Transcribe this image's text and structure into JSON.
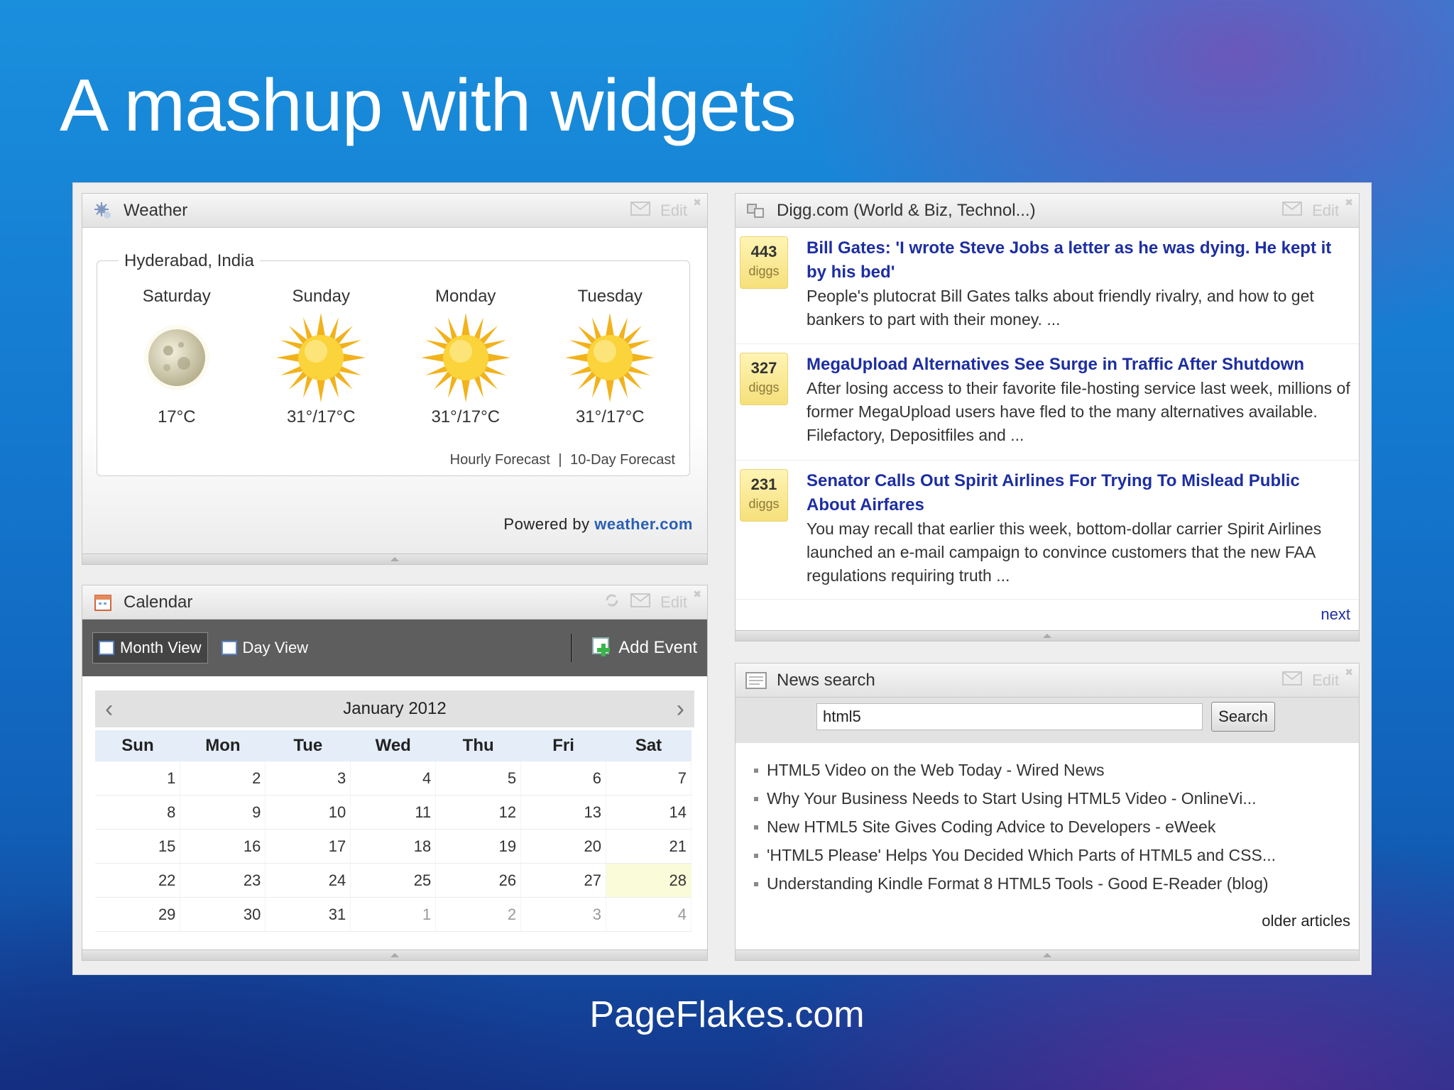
{
  "slide": {
    "title": "A mashup with widgets",
    "footer": "PageFlakes.com"
  },
  "widget_tools": {
    "edit_label": "Edit"
  },
  "weather": {
    "title": "Weather",
    "location": "Hyderabad, India",
    "days": [
      {
        "name": "Saturday",
        "icon": "moon-icon",
        "temp": "17°C"
      },
      {
        "name": "Sunday",
        "icon": "sun-icon",
        "temp": "31°/17°C"
      },
      {
        "name": "Monday",
        "icon": "sun-icon",
        "temp": "31°/17°C"
      },
      {
        "name": "Tuesday",
        "icon": "sun-icon",
        "temp": "31°/17°C"
      }
    ],
    "hourly_link": "Hourly Forecast",
    "separator": "|",
    "tenday_link": "10-Day Forecast",
    "powered_prefix": "Powered by",
    "powered_brand": "weather.com"
  },
  "calendar": {
    "title": "Calendar",
    "month_view_label": "Month View",
    "day_view_label": "Day View",
    "add_event_label": "Add Event",
    "month_label": "January 2012",
    "prev_arrow": "‹",
    "next_arrow": "›",
    "weekdays": [
      "Sun",
      "Mon",
      "Tue",
      "Wed",
      "Thu",
      "Fri",
      "Sat"
    ],
    "weeks": [
      [
        "1",
        "2",
        "3",
        "4",
        "5",
        "6",
        "7"
      ],
      [
        "8",
        "9",
        "10",
        "11",
        "12",
        "13",
        "14"
      ],
      [
        "15",
        "16",
        "17",
        "18",
        "19",
        "20",
        "21"
      ],
      [
        "22",
        "23",
        "24",
        "25",
        "26",
        "27",
        "28"
      ],
      [
        "29",
        "30",
        "31",
        "1",
        "2",
        "3",
        "4"
      ]
    ],
    "today": "28"
  },
  "digg": {
    "title": "Digg.com (World & Biz, Technol...)",
    "count_unit": "diggs",
    "items": [
      {
        "diggs": "443",
        "title": "Bill Gates: 'I wrote Steve Jobs a letter as he was dying. He kept it by his bed'",
        "desc": "People's plutocrat Bill Gates talks about friendly rivalry, and how to get bankers to part with their money. ..."
      },
      {
        "diggs": "327",
        "title": "MegaUpload Alternatives See Surge in Traffic After Shutdown",
        "desc": "After losing access to their favorite file-hosting service last week, millions of former MegaUpload users have fled to the many alternatives available. Filefactory, Depositfiles and ..."
      },
      {
        "diggs": "231",
        "title": "Senator Calls Out Spirit Airlines For Trying To Mislead Public About Airfares",
        "desc": "You may recall that earlier this week, bottom-dollar carrier Spirit Airlines launched an e-mail campaign to convince customers that the new FAA regulations requiring truth ..."
      }
    ],
    "next_label": "next"
  },
  "news_search": {
    "title": "News search",
    "query": "html5",
    "button_label": "Search",
    "results": [
      "HTML5 Video on the Web Today - Wired News",
      "Why Your Business Needs to Start Using HTML5 Video - OnlineVi...",
      "New HTML5 Site Gives Coding Advice to Developers - eWeek",
      "'HTML5 Please' Helps You Decided Which Parts of HTML5 and CSS...",
      "Understanding Kindle Format 8 HTML5 Tools - Good E-Reader (blog)"
    ],
    "older_label": "older articles"
  },
  "colors": {
    "link_blue": "#1d2ea1",
    "brand_blue": "#2a5fb4",
    "digg_badge": "#f5e07a",
    "today_highlight": "#fafbd8"
  }
}
